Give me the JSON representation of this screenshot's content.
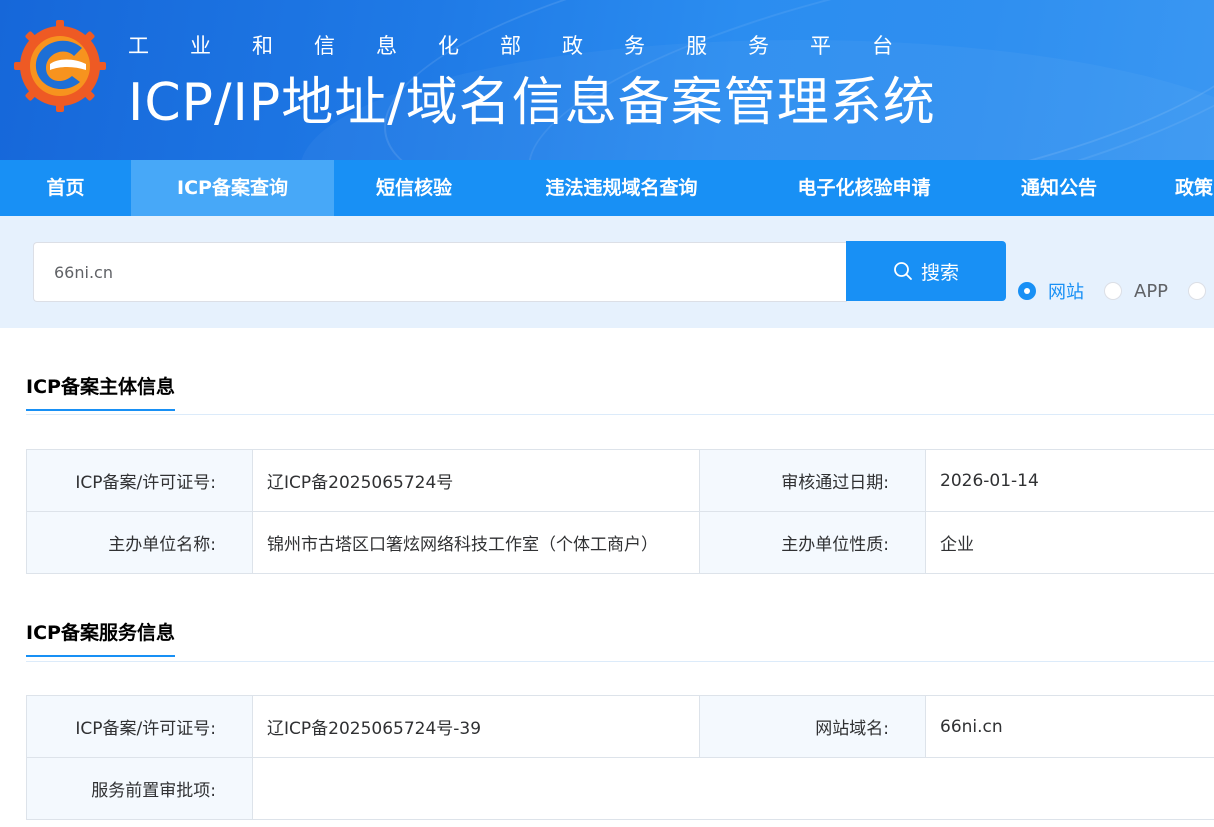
{
  "header": {
    "subtitle": "工业和信息化部政务服务平台",
    "title": "ICP/IP地址/域名信息备案管理系统"
  },
  "nav": {
    "items": [
      {
        "label": "首页",
        "active": false
      },
      {
        "label": "ICP备案查询",
        "active": true
      },
      {
        "label": "短信核验",
        "active": false
      },
      {
        "label": "违法违规域名查询",
        "active": false
      },
      {
        "label": "电子化核验申请",
        "active": false
      },
      {
        "label": "通知公告",
        "active": false
      },
      {
        "label": "政策",
        "active": false
      }
    ]
  },
  "search": {
    "value": "66ni.cn",
    "button_label": "搜索",
    "types": [
      {
        "label": "网站",
        "checked": true
      },
      {
        "label": "APP",
        "checked": false
      },
      {
        "label": "",
        "checked": false
      }
    ]
  },
  "subject_info": {
    "title": "ICP备案主体信息",
    "rows": [
      {
        "label1": "ICP备案/许可证号:",
        "value1": "辽ICP备2025065724号",
        "label2": "审核通过日期:",
        "value2": "2026-01-14"
      },
      {
        "label1": "主办单位名称:",
        "value1": "锦州市古塔区口箸炫网络科技工作室（个体工商户）",
        "label2": "主办单位性质:",
        "value2": "企业"
      }
    ]
  },
  "service_info": {
    "title": "ICP备案服务信息",
    "rows": [
      {
        "label1": "ICP备案/许可证号:",
        "value1": "辽ICP备2025065724号-39",
        "label2": "网站域名:",
        "value2": "66ni.cn"
      },
      {
        "label1": "服务前置审批项:",
        "value1": ""
      }
    ]
  },
  "colors": {
    "primary": "#1890f5",
    "nav_active": "#47a8f8",
    "search_bg": "#e6f1fd",
    "label_bg": "#f4f9fe"
  }
}
